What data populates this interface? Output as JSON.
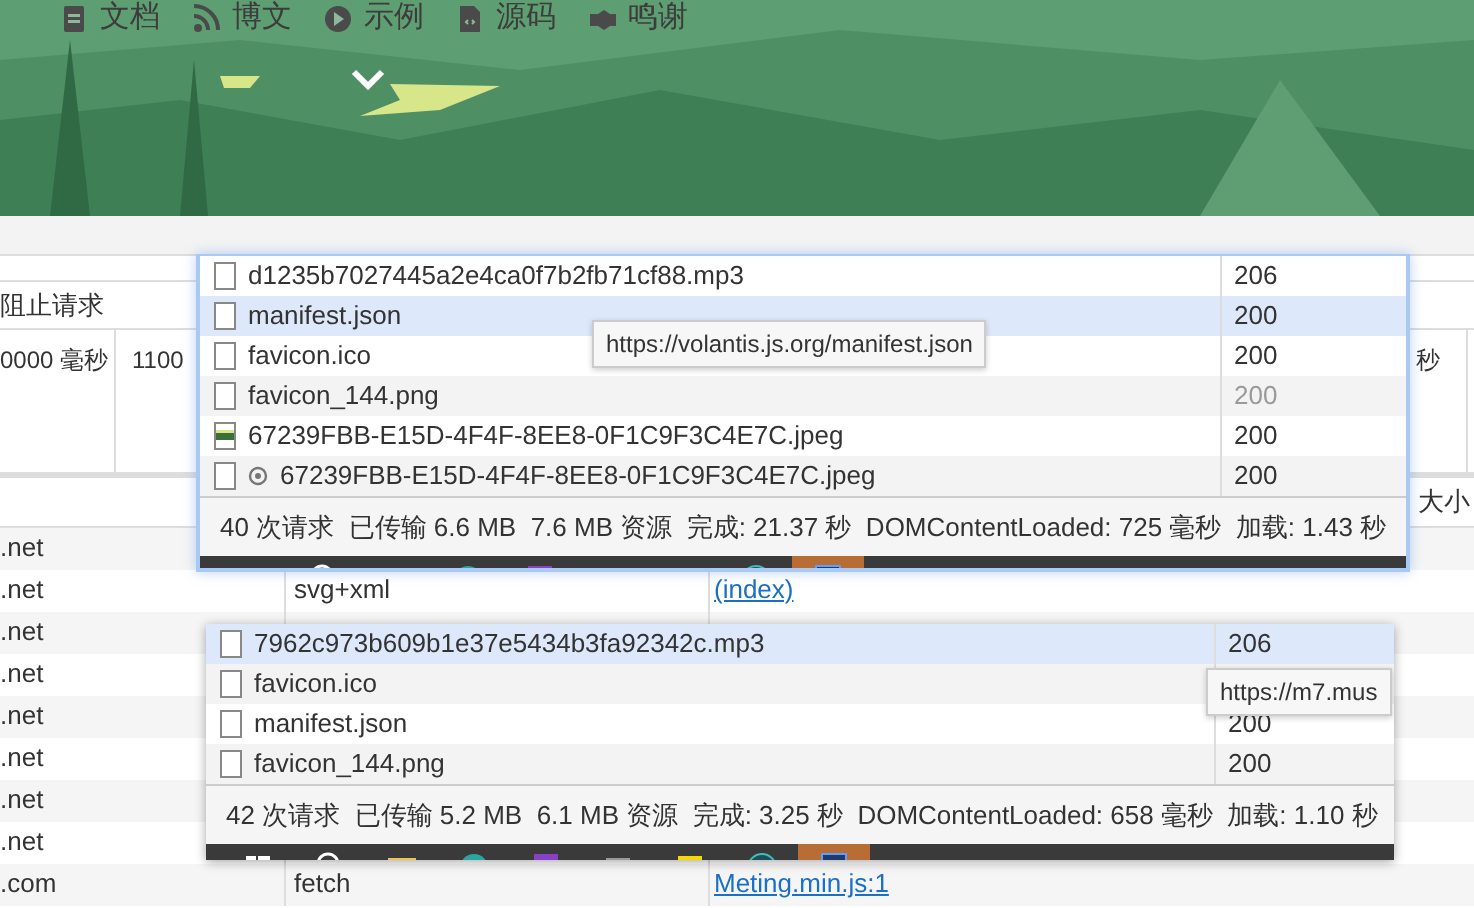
{
  "banner": {
    "nav": [
      {
        "label": "文档"
      },
      {
        "label": "博文"
      },
      {
        "label": "示例"
      },
      {
        "label": "源码"
      },
      {
        "label": "鸣谢"
      }
    ]
  },
  "devtools": {
    "block_label": "阻止请求",
    "throttle_cells": [
      "0000 毫秒",
      "1100",
      "秒"
    ],
    "size_header": "大小",
    "rows": [
      {
        "domain": ".net"
      },
      {
        "domain": ".net",
        "type": "svg+xml",
        "initiator": "(index)"
      },
      {
        "domain": ".net"
      },
      {
        "domain": ".net"
      },
      {
        "domain": ".net"
      },
      {
        "domain": ".net"
      },
      {
        "domain": ".net"
      },
      {
        "domain": ".net"
      },
      {
        "domain": ".com",
        "type": "fetch",
        "initiator": "Meting.min.js:1"
      }
    ]
  },
  "windows": [
    {
      "requests": [
        {
          "name": "d1235b7027445a2e4ca0f7b2fb71cf88.mp3",
          "status": "206",
          "kind": "file",
          "selected": false,
          "dimmed": false
        },
        {
          "name": "manifest.json",
          "status": "200",
          "kind": "file",
          "selected": true,
          "dimmed": false
        },
        {
          "name": "favicon.ico",
          "status": "200",
          "kind": "file",
          "selected": false,
          "dimmed": false
        },
        {
          "name": "favicon_144.png",
          "status": "200",
          "kind": "file",
          "selected": false,
          "dimmed": true
        },
        {
          "name": "67239FBB-E15D-4F4F-8EE8-0F1C9F3C4E7C.jpeg",
          "status": "200",
          "kind": "image",
          "selected": false,
          "dimmed": false
        },
        {
          "name": "67239FBB-E15D-4F4F-8EE8-0F1C9F3C4E7C.jpeg",
          "status": "200",
          "kind": "cached",
          "selected": false,
          "dimmed": false
        }
      ],
      "summary": "40 次请求  已传输 6.6 MB  7.6 MB 资源  完成: 21.37 秒  DOMContentLoaded: 725 毫秒  加载: 1.43 秒",
      "tooltip": "https://volantis.js.org/manifest.json"
    },
    {
      "requests": [
        {
          "name": "7962c973b609b1e37e5434b3fa92342c.mp3",
          "status": "206",
          "kind": "file",
          "selected": true
        },
        {
          "name": "favicon.ico",
          "kind": "file",
          "selected": false
        },
        {
          "name": "manifest.json",
          "status": "200",
          "kind": "file",
          "selected": false
        },
        {
          "name": "favicon_144.png",
          "status": "200",
          "kind": "file",
          "selected": false
        }
      ],
      "summary": "42 次请求  已传输 5.2 MB  6.1 MB 资源  完成: 3.25 秒  DOMContentLoaded: 658 毫秒  加载: 1.10 秒",
      "tooltip": "https://m7.mus"
    }
  ]
}
